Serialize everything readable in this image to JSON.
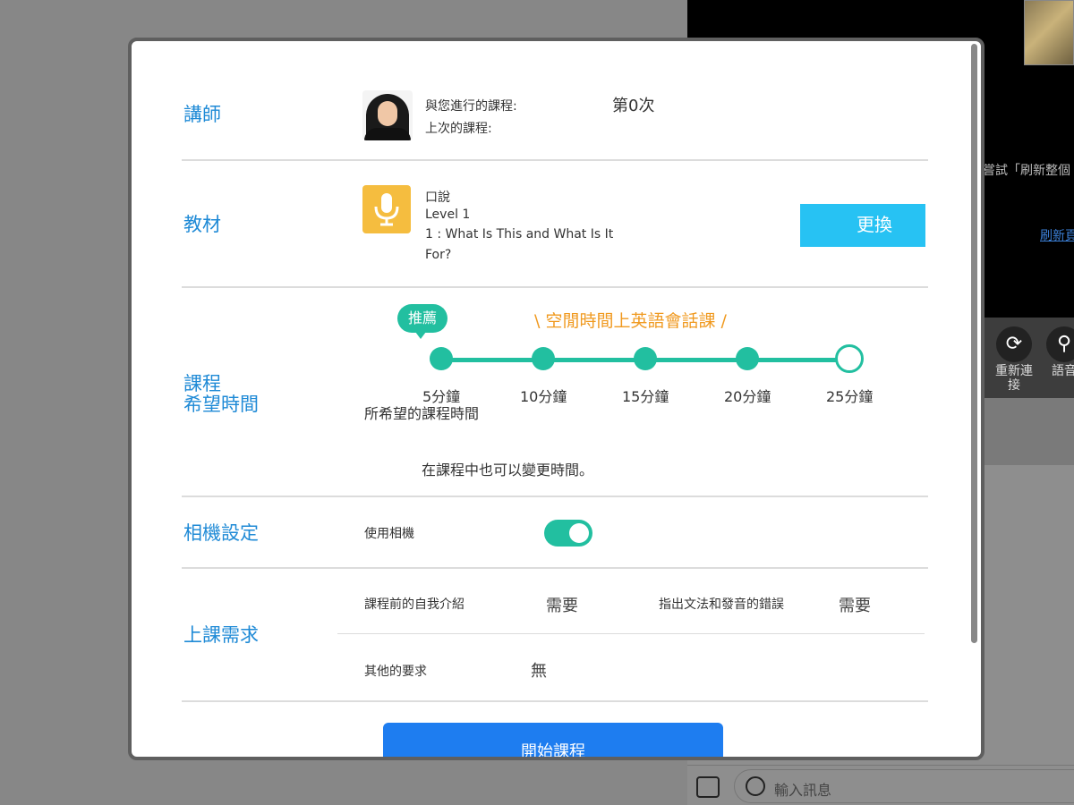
{
  "background": {
    "hint_text": "嘗試「刷新整個",
    "link_text": "刷新頁",
    "controls": [
      {
        "label": "重新連接",
        "icon": "refresh-icon"
      },
      {
        "label": "語音",
        "icon": "search-icon"
      }
    ],
    "chat_placeholder": "輸入訊息"
  },
  "modal": {
    "teacher": {
      "label": "講師",
      "sessions_label": "與您進行的課程:",
      "sessions_value": "第0次",
      "last_label": "上次的課程:"
    },
    "material": {
      "label": "教材",
      "category": "口說",
      "level": "Level 1",
      "lesson_line1": "1 : What Is This and What Is It",
      "lesson_line2": "For?",
      "change_button": "更換"
    },
    "duration": {
      "label_line1": "課程",
      "label_line2": "希望時間",
      "recommend_badge": "推薦",
      "slogan": "\\ 空閒時間上英語會話課 /",
      "options": [
        "5分鐘",
        "10分鐘",
        "15分鐘",
        "20分鐘",
        "25分鐘"
      ],
      "selected_index": 4,
      "caption": "所希望的課程時間",
      "hint": "在課程中也可以變更時間。"
    },
    "camera": {
      "label": "相機設定",
      "use_camera_label": "使用相機",
      "enabled": true
    },
    "requirements": {
      "label": "上課需求",
      "intro_label": "課程前的自我介紹",
      "intro_value": "需要",
      "correction_label": "指出文法和發音的錯誤",
      "correction_value": "需要",
      "other_label": "其他的要求",
      "other_value": "無"
    },
    "start_button": "開始課程"
  },
  "colors": {
    "accent_teal": "#22bfa0",
    "label_blue": "#1f8ad6",
    "slogan_orange": "#f09a20",
    "change_button": "#27c2f3",
    "start_button": "#1e7df0",
    "mic_yellow": "#f5bd3f"
  }
}
